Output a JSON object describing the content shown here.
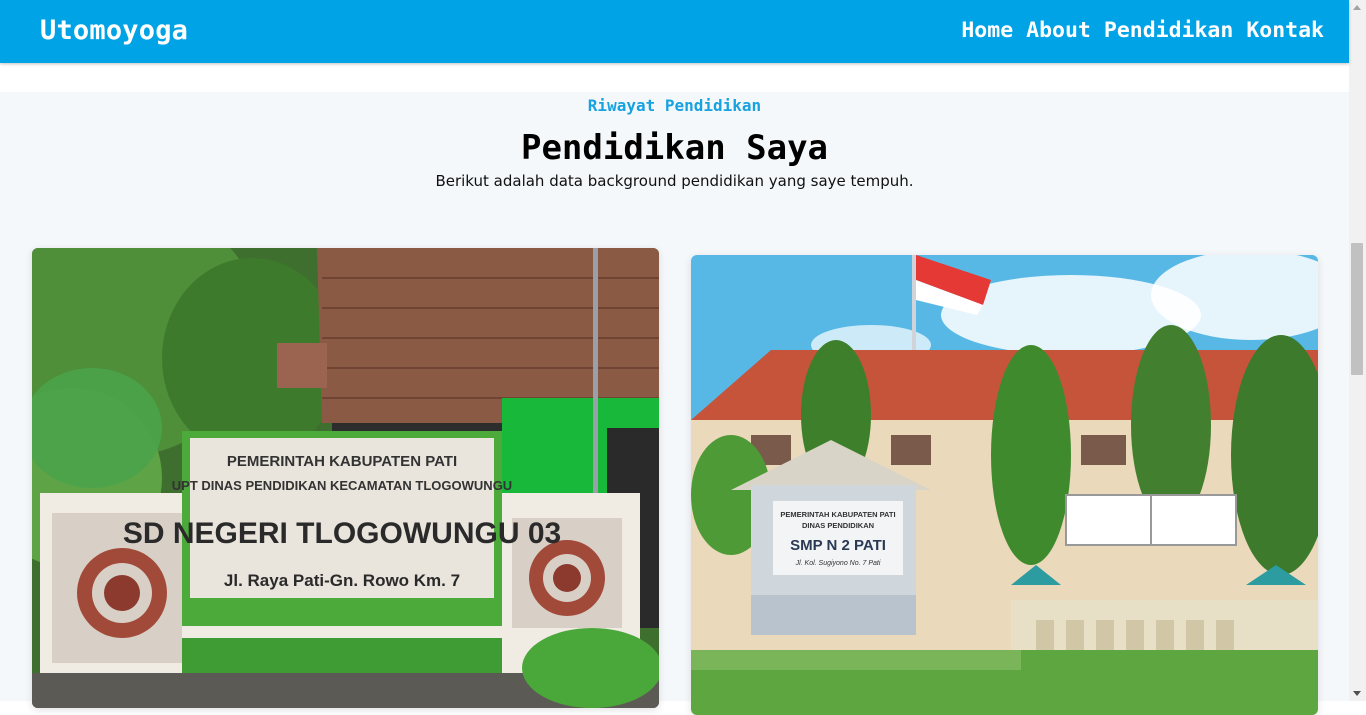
{
  "navbar": {
    "brand": "Utomoyoga",
    "links": [
      "Home",
      "About",
      "Pendidikan",
      "Kontak"
    ]
  },
  "section": {
    "eyebrow": "Riwayat Pendidikan",
    "title": "Pendidikan Saya",
    "subtitle": "Berikut adalah data background pendidikan yang saye tempuh."
  },
  "cards": [
    {
      "sign_line1": "PEMERINTAH KABUPATEN PATI",
      "sign_line2": "UPT DINAS PENDIDIKAN KECAMATAN TLOGOWUNGU",
      "sign_line3": "SD NEGERI TLOGOWUNGU 03",
      "sign_line4": "Jl. Raya Pati-Gn. Rowo Km. 7"
    },
    {
      "sign_line1": "PEMERINTAH KABUPATEN PATI",
      "sign_line2": "DINAS PENDIDIKAN",
      "sign_line3": "SMP N 2 PATI",
      "sign_line4": "Jl. Kol. Sugiyono No. 7 Pati"
    }
  ],
  "colors": {
    "navbar": "#00a3e6",
    "accent": "#17a2e0",
    "section_bg": "#f5f8fb"
  }
}
